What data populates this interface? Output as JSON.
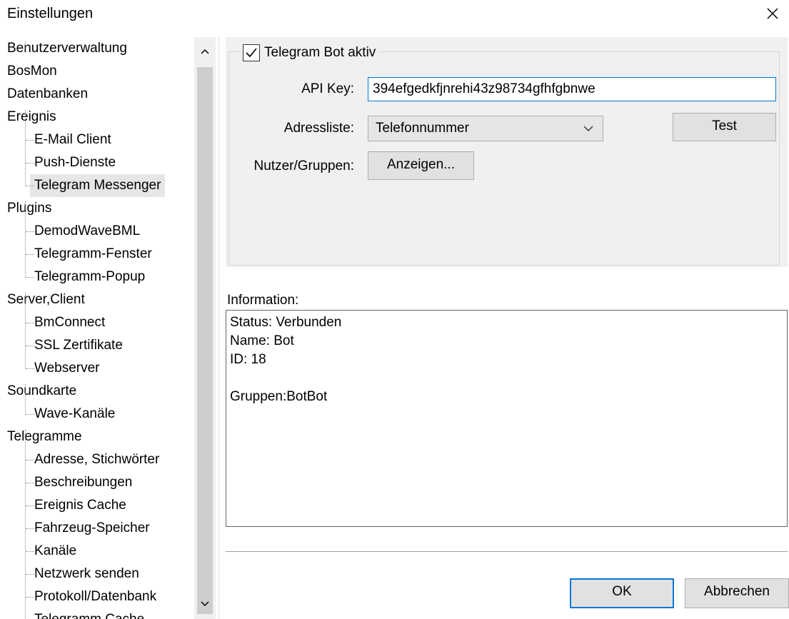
{
  "window": {
    "title": "Einstellungen"
  },
  "tree": {
    "items": [
      {
        "label": "Benutzerverwaltung",
        "level": 0
      },
      {
        "label": "BosMon",
        "level": 0
      },
      {
        "label": "Datenbanken",
        "level": 0
      },
      {
        "label": "Ereignis",
        "level": 0
      },
      {
        "label": "E-Mail Client",
        "level": 1
      },
      {
        "label": "Push-Dienste",
        "level": 1
      },
      {
        "label": "Telegram Messenger",
        "level": 1,
        "selected": true
      },
      {
        "label": "Plugins",
        "level": 0
      },
      {
        "label": "DemodWaveBML",
        "level": 1
      },
      {
        "label": "Telegramm-Fenster",
        "level": 1
      },
      {
        "label": "Telegramm-Popup",
        "level": 1
      },
      {
        "label": "Server,Client",
        "level": 0
      },
      {
        "label": "BmConnect",
        "level": 1
      },
      {
        "label": "SSL Zertifikate",
        "level": 1
      },
      {
        "label": "Webserver",
        "level": 1
      },
      {
        "label": "Soundkarte",
        "level": 0
      },
      {
        "label": "Wave-Kanäle",
        "level": 1
      },
      {
        "label": "Telegramme",
        "level": 0
      },
      {
        "label": "Adresse, Stichwörter",
        "level": 1
      },
      {
        "label": "Beschreibungen",
        "level": 1
      },
      {
        "label": "Ereignis Cache",
        "level": 1
      },
      {
        "label": "Fahrzeug-Speicher",
        "level": 1
      },
      {
        "label": "Kanäle",
        "level": 1
      },
      {
        "label": "Netzwerk senden",
        "level": 1
      },
      {
        "label": "Protokoll/Datenbank",
        "level": 1
      },
      {
        "label": "Telegramm Cache",
        "level": 1
      }
    ]
  },
  "bot": {
    "active_label": "Telegram Bot aktiv",
    "active_checked": true,
    "api_key_label": "API Key:",
    "api_key_value": "394efgedkfjnrehi43z98734gfhfgbnwe",
    "address_list_label": "Adressliste:",
    "address_list_value": "Telefonnummer",
    "test_label": "Test",
    "users_label": "Nutzer/Gruppen:",
    "show_label": "Anzeigen..."
  },
  "info": {
    "label": "Information:",
    "lines": [
      "Status: Verbunden",
      "Name: Bot",
      "ID: 18",
      "",
      "Gruppen:BotBot"
    ]
  },
  "footer": {
    "ok_label": "OK",
    "cancel_label": "Abbrechen"
  },
  "colors": {
    "accent": "#0078d7",
    "panel": "#f0f0f0",
    "selection": "#e6e6e6"
  }
}
